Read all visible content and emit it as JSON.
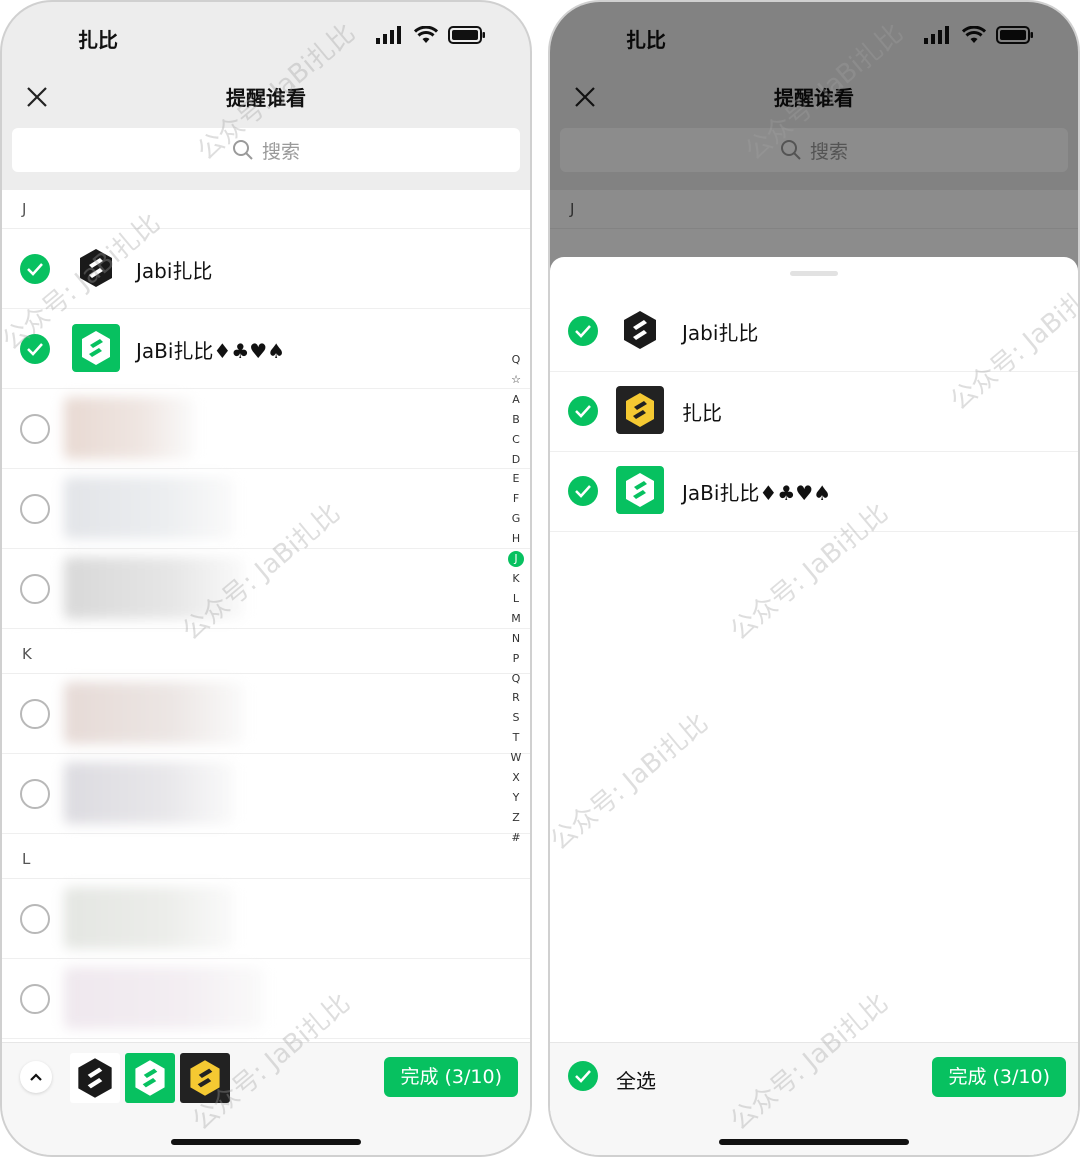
{
  "status": {
    "carrier_name": "扎比"
  },
  "nav": {
    "title": "提醒谁看"
  },
  "search": {
    "placeholder": "搜索"
  },
  "left": {
    "sections": [
      "J",
      "K",
      "L"
    ],
    "contacts": [
      {
        "name": "Jabi扎比",
        "checked": true
      },
      {
        "name": "JaBi扎比♦♣♥♠",
        "checked": true
      }
    ],
    "index_letters": [
      "Q",
      "☆",
      "A",
      "B",
      "C",
      "D",
      "E",
      "F",
      "G",
      "H",
      "J",
      "K",
      "L",
      "M",
      "N",
      "P",
      "Q",
      "R",
      "S",
      "T",
      "W",
      "X",
      "Y",
      "Z",
      "#"
    ],
    "done_label": "完成 (3/10)"
  },
  "right": {
    "section_peek": "J",
    "selected": [
      {
        "name": "Jabi扎比"
      },
      {
        "name": "扎比"
      },
      {
        "name": "JaBi扎比♦♣♥♠"
      }
    ],
    "select_all_label": "全选",
    "done_label": "完成 (3/10)"
  },
  "watermark": "公众号: JaBi扎比",
  "colors": {
    "accent": "#07c160",
    "logo_dark": "#1a1a1a",
    "logo_green": "#07c160",
    "logo_yellow": "#f5c932"
  }
}
